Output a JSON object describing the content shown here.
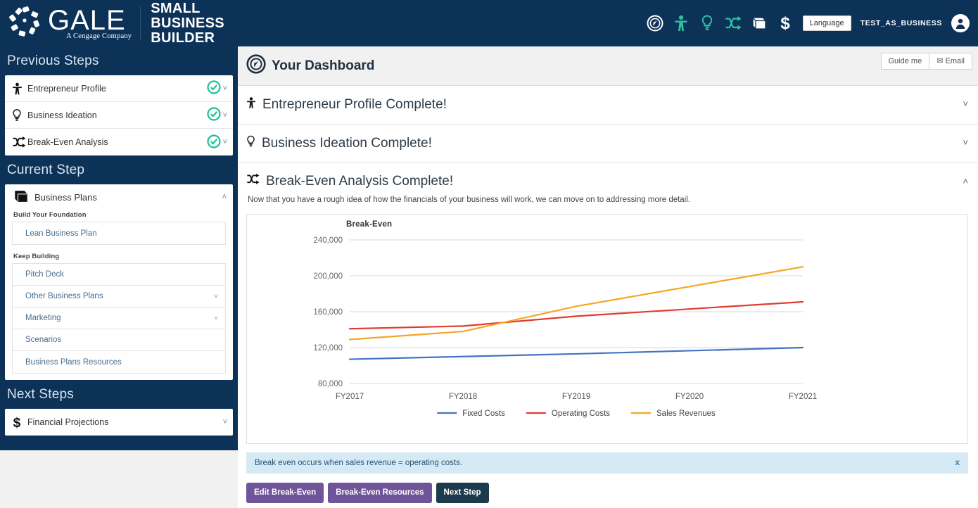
{
  "header": {
    "brand_word": "GALE",
    "brand_sub": "A Cengage Company",
    "product_name": "SMALL BUSINESS BUILDER",
    "language_button": "Language",
    "user_name": "TEST_AS_BUSINESS",
    "icons": [
      "compass-icon",
      "person-icon",
      "lightbulb-icon",
      "shuffle-icon",
      "book-icon",
      "dollar-icon"
    ]
  },
  "sidebar": {
    "previous_steps_title": "Previous Steps",
    "previous_steps": [
      {
        "label": "Entrepreneur Profile",
        "icon": "person-icon",
        "complete": true
      },
      {
        "label": "Business Ideation",
        "icon": "lightbulb-icon",
        "complete": true
      },
      {
        "label": "Break-Even Analysis",
        "icon": "shuffle-icon",
        "complete": true
      }
    ],
    "current_step_title": "Current Step",
    "current_step": {
      "label": "Business Plans",
      "icon": "book-icon",
      "groups": [
        {
          "label": "Build Your Foundation",
          "items": [
            {
              "label": "Lean Business Plan",
              "expandable": false
            }
          ]
        },
        {
          "label": "Keep Building",
          "items": [
            {
              "label": "Pitch Deck",
              "expandable": false
            },
            {
              "label": "Other Business Plans",
              "expandable": true
            },
            {
              "label": "Marketing",
              "expandable": true
            },
            {
              "label": "Scenarios",
              "expandable": false
            },
            {
              "label": "Business Plans Resources",
              "expandable": false
            }
          ]
        }
      ]
    },
    "next_steps_title": "Next Steps",
    "next_steps": [
      {
        "label": "Financial Projections",
        "icon": "dollar-icon"
      }
    ]
  },
  "main": {
    "dashboard_title": "Your Dashboard",
    "guide_me_label": "Guide me",
    "email_label": "Email",
    "sections": [
      {
        "title": "Entrepreneur Profile Complete!",
        "icon": "person-icon",
        "expanded": false
      },
      {
        "title": "Business Ideation Complete!",
        "icon": "lightbulb-icon",
        "expanded": false
      },
      {
        "title": "Break-Even Analysis Complete!",
        "icon": "shuffle-icon",
        "expanded": true,
        "description": "Now that you have a rough idea of how the financials of your business will work, we can move on to addressing more detail."
      }
    ],
    "info_message": "Break even occurs when sales revenue = operating costs.",
    "info_close": "x",
    "buttons": [
      {
        "label": "Edit Break-Even",
        "style": "purple"
      },
      {
        "label": "Break-Even Resources",
        "style": "purple"
      },
      {
        "label": "Next Step",
        "style": "dark"
      }
    ]
  },
  "chart_data": {
    "type": "line",
    "title": "Break-Even",
    "xlabel": "",
    "ylabel": "",
    "categories": [
      "FY2017",
      "FY2018",
      "FY2019",
      "FY2020",
      "FY2021"
    ],
    "ylim": [
      80000,
      240000
    ],
    "yticks": [
      80000,
      120000,
      160000,
      200000,
      240000
    ],
    "ytick_labels": [
      "80,000",
      "120,000",
      "160,000",
      "200,000",
      "240,000"
    ],
    "grid": true,
    "legend_position": "bottom",
    "series": [
      {
        "name": "Fixed Costs",
        "color": "#4472c4",
        "values": [
          107000,
          110000,
          113000,
          116500,
          120000
        ]
      },
      {
        "name": "Operating Costs",
        "color": "#e03c31",
        "values": [
          141000,
          144000,
          155000,
          163000,
          171000
        ]
      },
      {
        "name": "Sales Revenues",
        "color": "#f5a623",
        "values": [
          129000,
          138000,
          166000,
          188000,
          210000
        ]
      }
    ]
  }
}
